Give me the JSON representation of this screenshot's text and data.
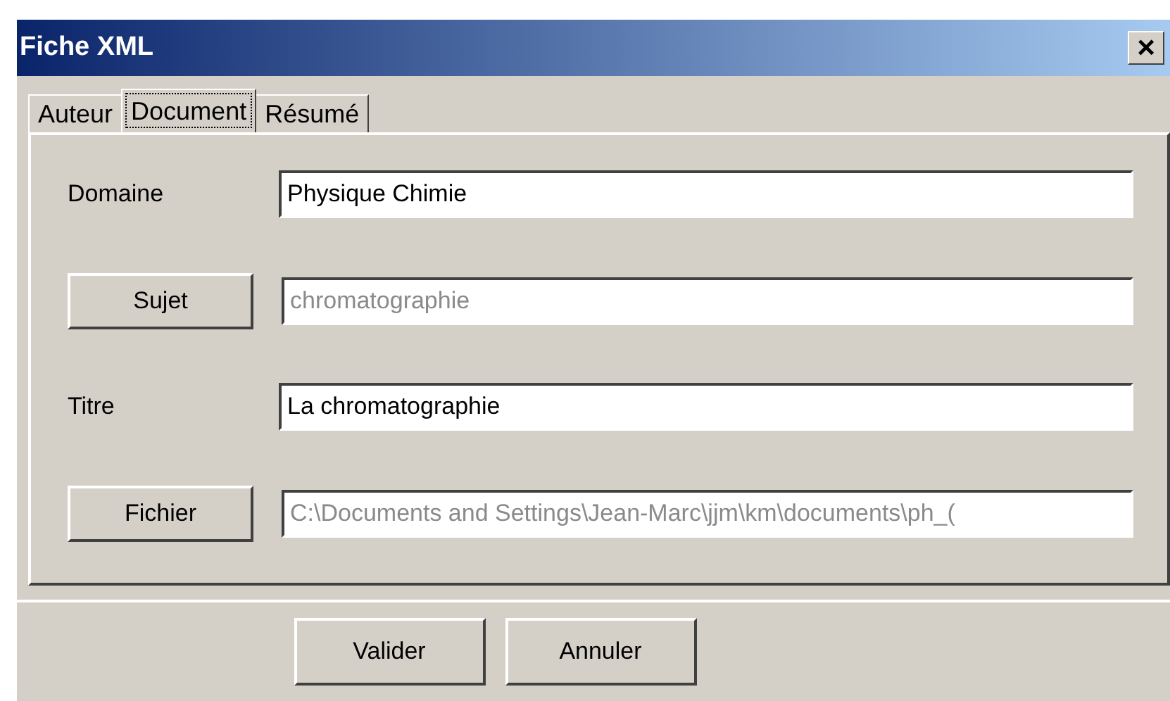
{
  "window": {
    "title": "Fiche XML",
    "close": "×"
  },
  "tabs": [
    {
      "label": "Auteur",
      "selected": false
    },
    {
      "label": "Document",
      "selected": true
    },
    {
      "label": "Résumé",
      "selected": false
    }
  ],
  "fields": [
    {
      "kind": "label",
      "label": "Domaine",
      "value": "Physique Chimie",
      "disabled": false
    },
    {
      "kind": "button",
      "label": "Sujet",
      "value": "chromatographie",
      "disabled": true
    },
    {
      "kind": "label",
      "label": "Titre",
      "value": "La chromatographie",
      "disabled": false
    },
    {
      "kind": "button",
      "label": "Fichier",
      "value": "C:\\Documents and Settings\\Jean-Marc\\jjm\\km\\documents\\ph_(",
      "disabled": true
    }
  ],
  "buttons": [
    "Valider",
    "Annuler"
  ]
}
